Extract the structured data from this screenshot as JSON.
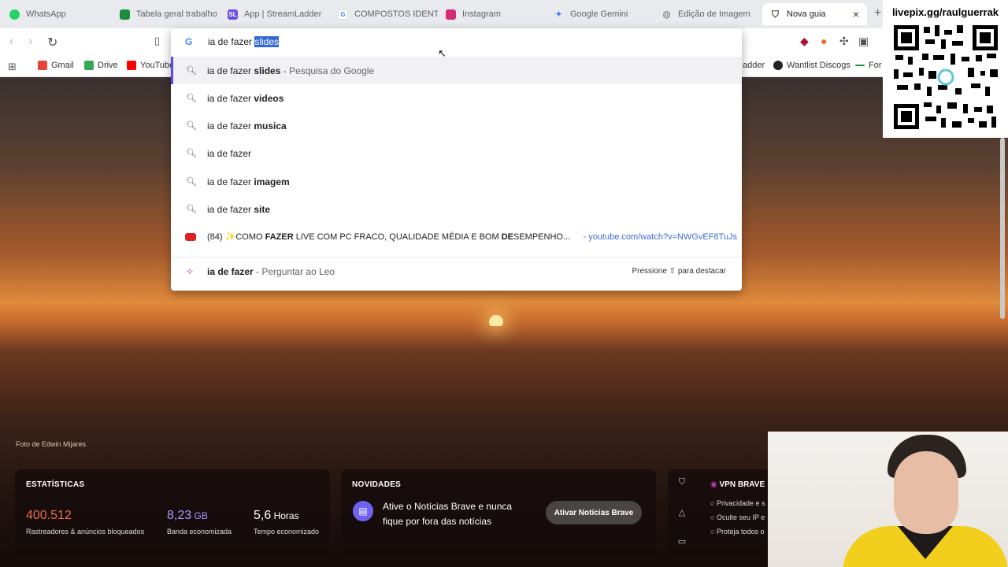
{
  "tabs": [
    {
      "label": "WhatsApp",
      "icon": "whatsapp-icon",
      "color": "#25d366"
    },
    {
      "label": "Tabela geral trabalho",
      "icon": "sheets-icon",
      "color": "#1e8e3e"
    },
    {
      "label": "App | StreamLadder",
      "icon": "streamladder-icon",
      "color": "#6b4de6"
    },
    {
      "label": "COMPOSTOS IDENTI",
      "icon": "google-icon",
      "color": "#4285f4"
    },
    {
      "label": "Instagram",
      "icon": "instagram-icon",
      "color": "#d62976"
    },
    {
      "label": "Google Gemini",
      "icon": "gemini-icon",
      "color": "#4a7bf7"
    },
    {
      "label": "Edição de Imagem",
      "icon": "globe-icon",
      "color": "#888888"
    },
    {
      "label": "Nova guia",
      "icon": "brave-icon",
      "color": "#555555"
    }
  ],
  "toolbar": {
    "new_tab": "+"
  },
  "bookmarks": {
    "items": [
      {
        "label": "Gmail",
        "color": "#ea4335"
      },
      {
        "label": "Drive",
        "color": "#34a853"
      },
      {
        "label": "YouTube",
        "color": "#ff0000"
      }
    ],
    "right_items": [
      {
        "label": "adder",
        "color": "#6b4de6"
      },
      {
        "label": "Wantlist Discogs",
        "color": "#222222"
      },
      {
        "label": "For",
        "color": "#1e8e3e"
      }
    ]
  },
  "omnibox": {
    "typed": "ia de fazer ",
    "completion": "slides",
    "suggestions": [
      {
        "prefix": "ia de fazer ",
        "bold": "slides",
        "hint": " - Pesquisa do Google"
      },
      {
        "prefix": "ia de fazer ",
        "bold": "videos",
        "hint": ""
      },
      {
        "prefix": "ia de fazer ",
        "bold": "musica",
        "hint": ""
      },
      {
        "prefix": "ia de fazer",
        "bold": "",
        "hint": ""
      },
      {
        "prefix": "ia de fazer ",
        "bold": "imagem",
        "hint": ""
      },
      {
        "prefix": "ia de fazer ",
        "bold": "site",
        "hint": ""
      }
    ],
    "youtube": {
      "t1": "(84) ✨COMO ",
      "b1": "FAZER",
      "t2": " LIVE COM PC FRACO, QUALIDADE MÉDIA E BOM ",
      "b2": "DE",
      "t3": "SEMPENHO...",
      "url": "- youtube.com/watch?v=NWGvEF8TuJs"
    },
    "leo": {
      "query": "ia de fazer",
      "hint": " - Perguntar ao Leo",
      "shortcut": "Pressione ⇧ para destacar"
    }
  },
  "background": {
    "photo_credit": "Foto de Edwin Mijares"
  },
  "stats": {
    "title": "ESTATÍSTICAS",
    "trackers": {
      "value": "400.512",
      "label": "Rastreadores & anúncios bloqueados"
    },
    "bandwidth": {
      "value": "8,23",
      "unit": "GB",
      "label": "Banda economizada"
    },
    "time": {
      "value": "5,6",
      "unit": "Horas",
      "label": "Tempo economizado"
    }
  },
  "news": {
    "title": "NOVIDADES",
    "text": "Ative o Notícias Brave e nunca fique por fora das notícias",
    "button": "Ativar Notícias Brave"
  },
  "vpn": {
    "title": "VPN BRAVE",
    "items": [
      "Privacidade e s",
      "Oculte seu IP e",
      "Proteja todos o"
    ]
  },
  "overlay": {
    "livepix": "livepix.gg/raulguerrak"
  },
  "colors": {
    "accent": "#5b47f2",
    "trackers": "#ef6b4f",
    "bandwidth": "#a99bff"
  }
}
